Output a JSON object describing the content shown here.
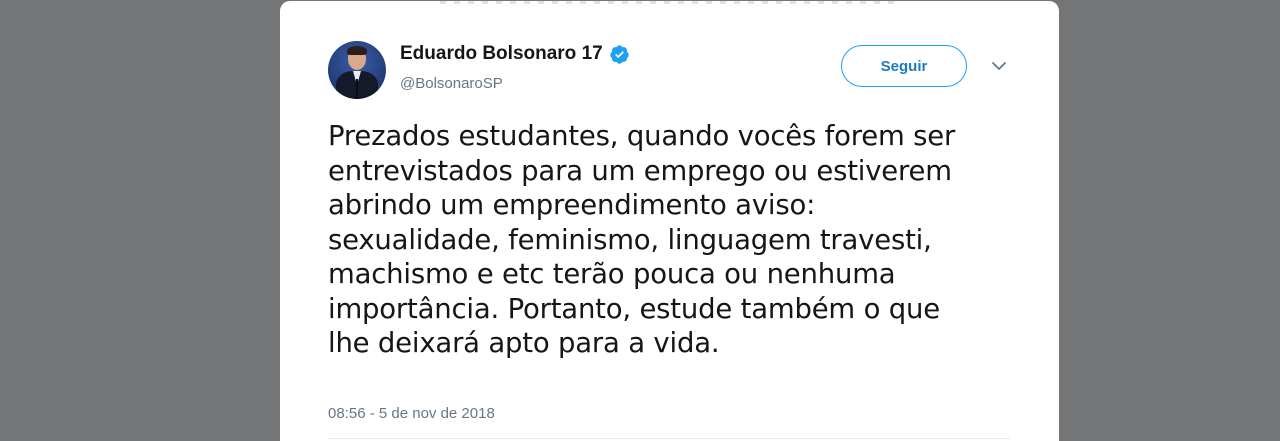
{
  "tweet": {
    "author": {
      "display_name": "Eduardo Bolsonaro 17",
      "handle": "@BolsonaroSP",
      "verified": true,
      "avatar_icon": "profile-photo"
    },
    "follow_button_label": "Seguir",
    "more_options_icon": "chevron-down-icon",
    "text": "Prezados estudantes, quando vocês forem ser\nentrevistados para um emprego ou estiverem\nabrindo um empreendimento aviso:\nsexualidade, feminismo, linguagem travesti,\nmachismo e etc terão pouca ou nenhuma\nimportância. Portanto, estude também o que\nlhe deixará apto para a vida.",
    "timestamp": "08:56 - 5 de nov de 2018"
  },
  "colors": {
    "background": "#737577",
    "card": "#ffffff",
    "accent": "#1da1f2",
    "text_primary": "#14171a",
    "text_secondary": "#657786"
  }
}
